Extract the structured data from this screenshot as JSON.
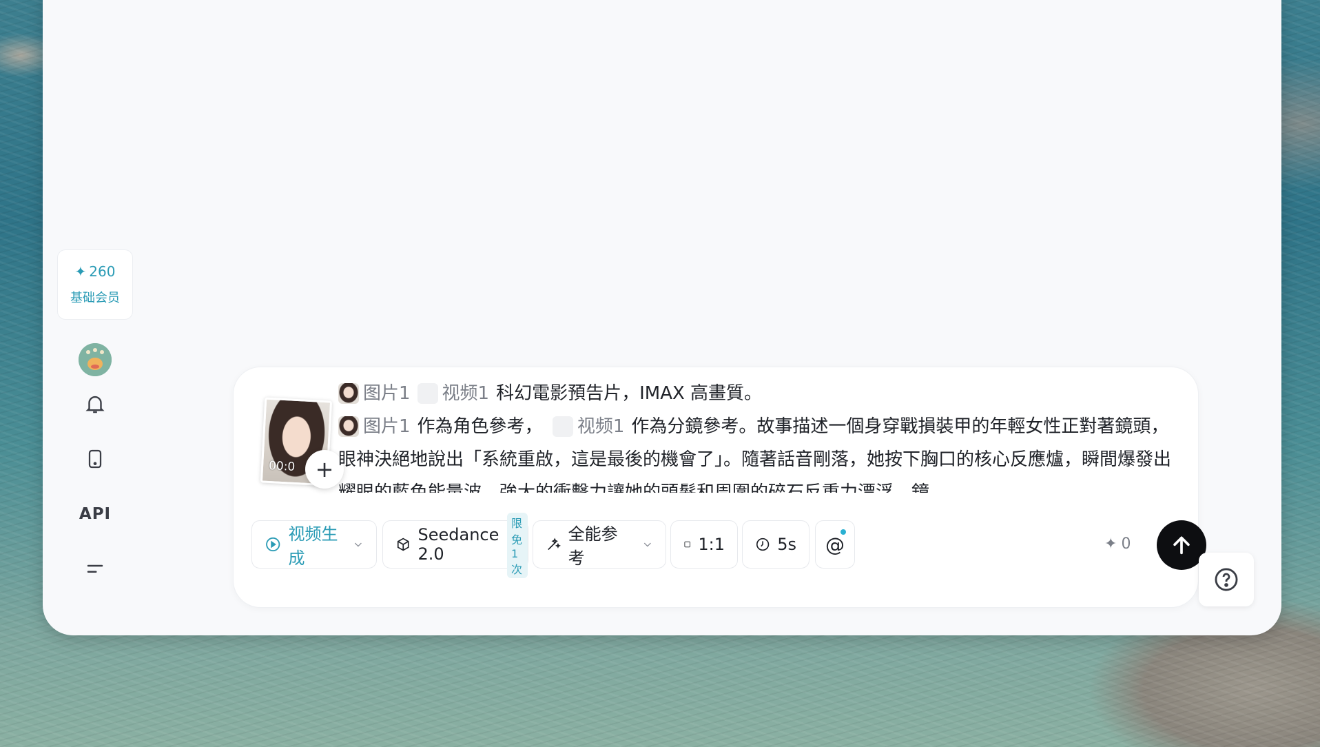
{
  "sidebar": {
    "credits": "260",
    "tier": "基础会员",
    "api_label": "API",
    "icons": [
      "avatar",
      "bell-icon",
      "tablet-icon",
      "api-link",
      "menu-icon"
    ]
  },
  "composer": {
    "reference_time": "00:0",
    "prompt": {
      "line1": {
        "image_chip": "图片1",
        "video_chip": "视频1",
        "text": "科幻電影預告片，IMAX 高畫質。"
      },
      "line2": {
        "image_chip": "图片1",
        "text_a": "作為角色參考，",
        "video_chip": "视频1",
        "text_b": "作為分鏡參考。故事描述一個身穿戰損裝甲的年輕女性正對著鏡頭，眼神決絕地說出「系統重啟，這是最後的機會了」。隨著話音剛落，她按下胸口的核心反應爐，瞬間爆發出耀眼的藍色能量波，強大的衝擊力讓她的頭髮和周圍的碎石反重力漂浮。鏡"
      }
    },
    "toolbar": {
      "mode_label": "视频生成",
      "model_label": "Seedance 2.0",
      "model_badge": "限免1次",
      "reference_label": "全能参考",
      "ratio_label": "1:1",
      "duration_label": "5s",
      "mention_label": "@",
      "cost": "0"
    }
  },
  "colors": {
    "accent": "#2a9bb5",
    "send_bg": "#0d0e11"
  }
}
